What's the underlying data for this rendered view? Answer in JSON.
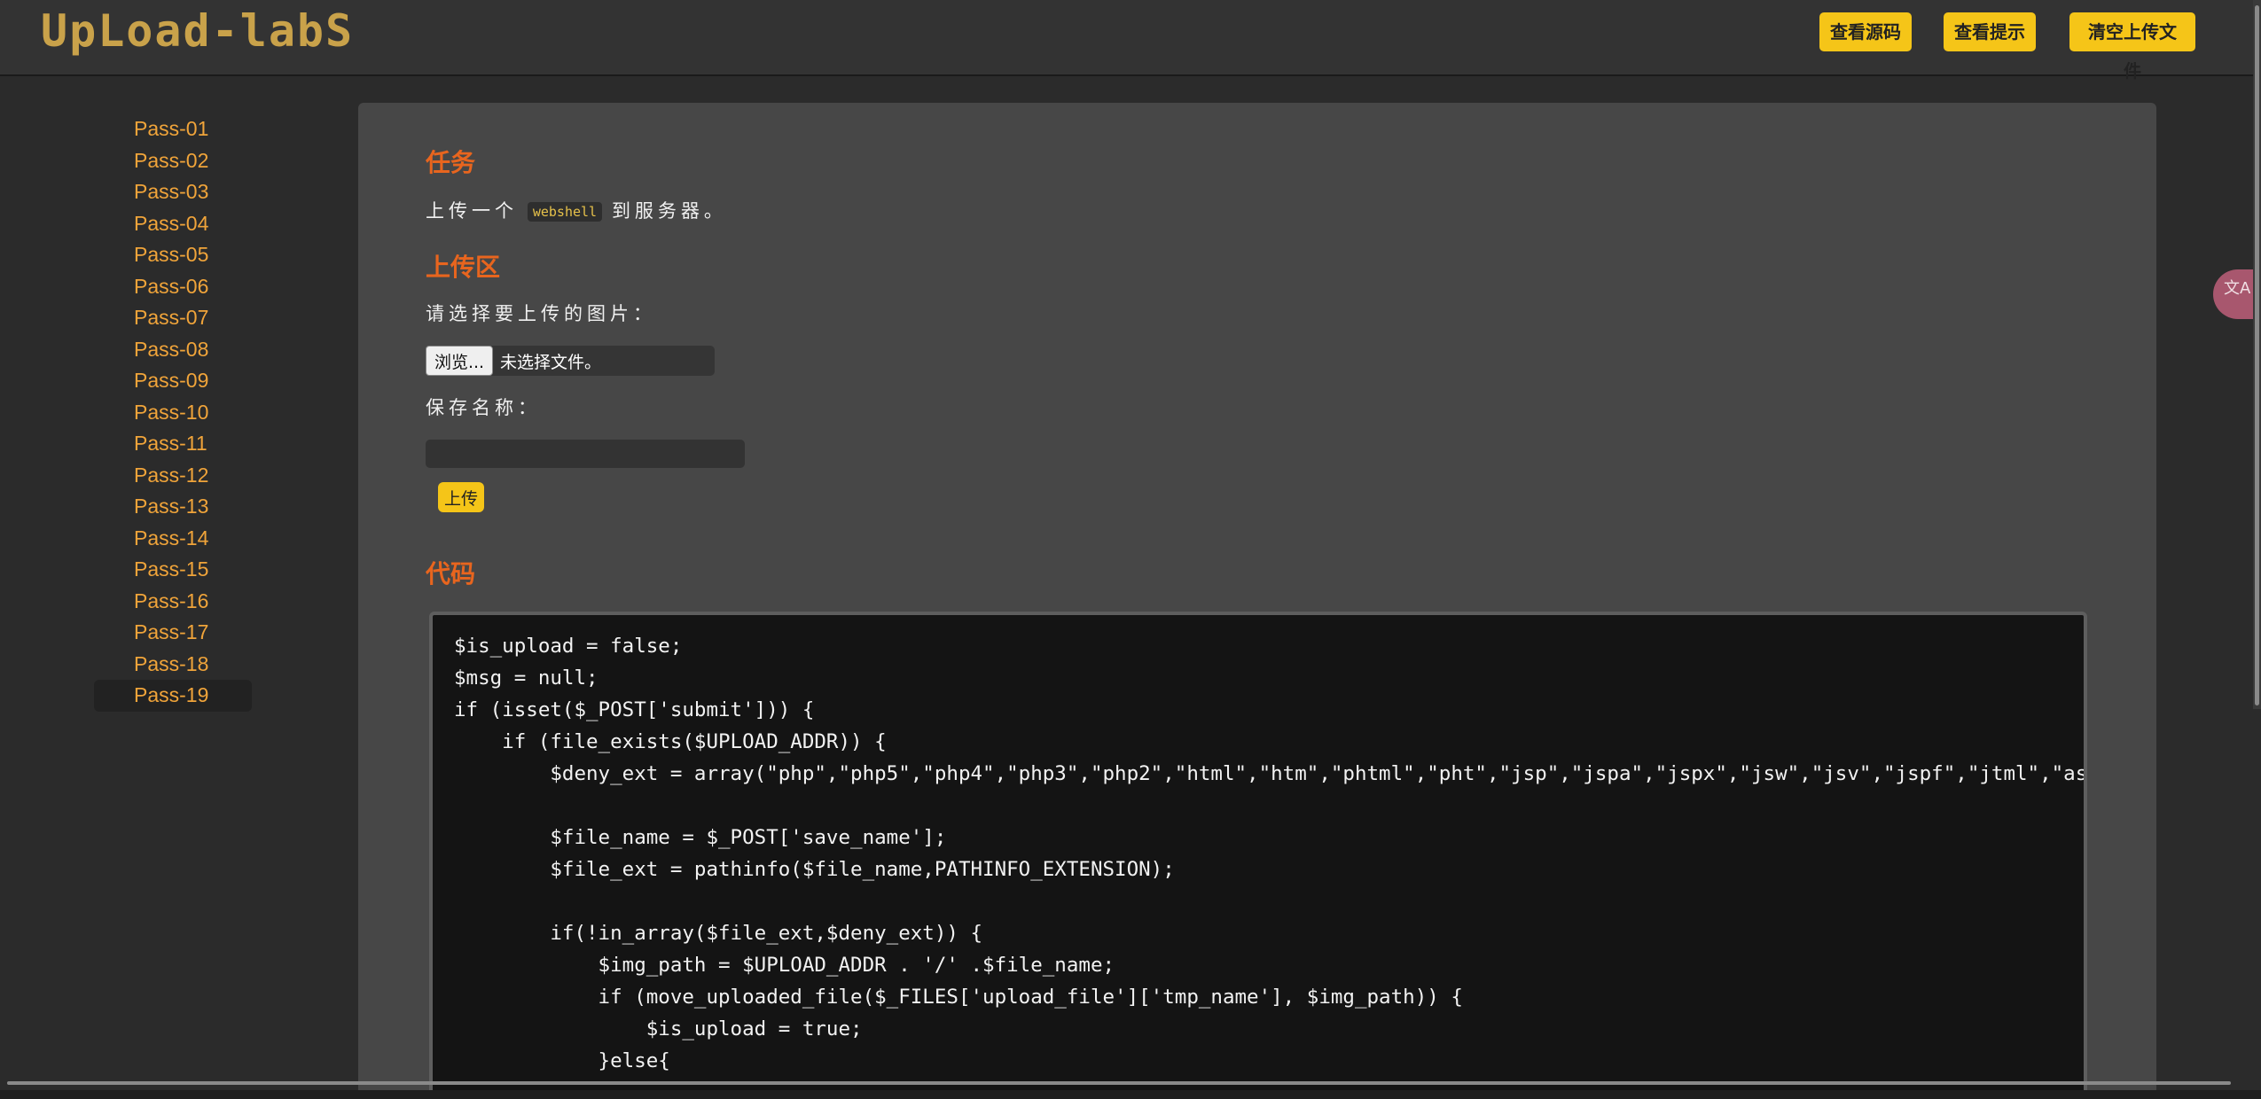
{
  "header": {
    "logo_text": "UpLoad-labS",
    "buttons": [
      "查看源码",
      "查看提示",
      "清空上传文件"
    ]
  },
  "sidebar": {
    "items": [
      "Pass-01",
      "Pass-02",
      "Pass-03",
      "Pass-04",
      "Pass-05",
      "Pass-06",
      "Pass-07",
      "Pass-08",
      "Pass-09",
      "Pass-10",
      "Pass-11",
      "Pass-12",
      "Pass-13",
      "Pass-14",
      "Pass-15",
      "Pass-16",
      "Pass-17",
      "Pass-18",
      "Pass-19"
    ],
    "active": "Pass-19"
  },
  "main": {
    "task_title": "任务",
    "task_prefix": "上传一个",
    "task_code": "webshell",
    "task_suffix": "到服务器。",
    "upload_title": "上传区",
    "choose_label": "请选择要上传的图片：",
    "browse_label": "浏览...",
    "file_status": "未选择文件。",
    "save_name_label": "保存名称：",
    "save_name_value": "",
    "upload_button": "上传",
    "code_title": "代码",
    "code_lines": [
      "$is_upload = false;",
      "$msg = null;",
      "if (isset($_POST['submit'])) {",
      "    if (file_exists($UPLOAD_ADDR)) {",
      "        $deny_ext = array(\"php\",\"php5\",\"php4\",\"php3\",\"php2\",\"html\",\"htm\",\"phtml\",\"pht\",\"jsp\",\"jspa\",\"jspx\",\"jsw\",\"jsv\",\"jspf\",\"jtml\",\"asp\",\"",
      "",
      "        $file_name = $_POST['save_name'];",
      "        $file_ext = pathinfo($file_name,PATHINFO_EXTENSION);",
      "",
      "        if(!in_array($file_ext,$deny_ext)) {",
      "            $img_path = $UPLOAD_ADDR . '/' .$file_name;",
      "            if (move_uploaded_file($_FILES['upload_file']['tmp_name'], $img_path)) {",
      "                $is_upload = true;",
      "            }else{"
    ]
  },
  "translate_icon": "translate-icon",
  "colors": {
    "accent": "#f5c518",
    "title": "#e8651e",
    "link": "#f0a43a",
    "panel": "#474747",
    "background": "#2b2b2b"
  }
}
